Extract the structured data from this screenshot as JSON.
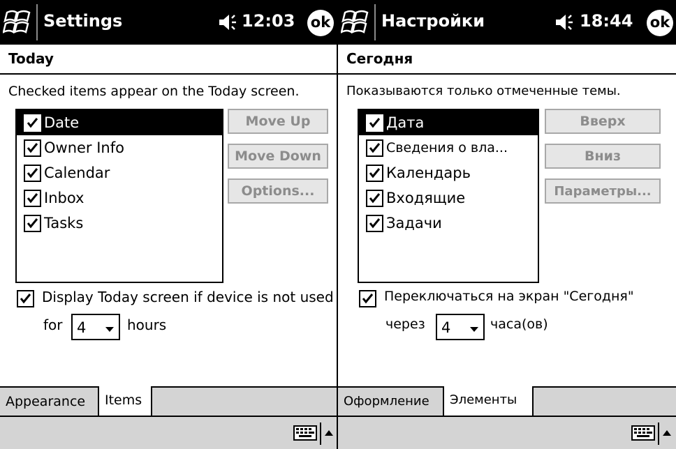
{
  "left": {
    "app_title": "Settings",
    "clock": "12:03",
    "ok_label": "ok",
    "page_title": "Today",
    "instruction": "Checked items appear on the Today screen.",
    "items": [
      {
        "label": "Date",
        "checked": true,
        "selected": true
      },
      {
        "label": "Owner Info",
        "checked": true
      },
      {
        "label": "Calendar",
        "checked": true
      },
      {
        "label": "Inbox",
        "checked": true
      },
      {
        "label": "Tasks",
        "checked": true
      }
    ],
    "buttons": {
      "move_up": "Move Up",
      "move_down": "Move Down",
      "options": "Options..."
    },
    "display_option": {
      "label": "Display Today screen if device is not used",
      "checked": true
    },
    "for_label": "for",
    "hours_value": "4",
    "hours_label": "hours",
    "tabs": {
      "appearance": "Appearance",
      "items": "Items"
    }
  },
  "right": {
    "app_title": "Настройки",
    "clock": "18:44",
    "ok_label": "ok",
    "page_title": "Сегодня",
    "instruction": "Показываются только отмеченные темы.",
    "items": [
      {
        "label": "Дата",
        "checked": true,
        "selected": true
      },
      {
        "label": "Сведения о вла...",
        "checked": true
      },
      {
        "label": "Календарь",
        "checked": true
      },
      {
        "label": "Входящие",
        "checked": true
      },
      {
        "label": "Задачи",
        "checked": true
      }
    ],
    "buttons": {
      "move_up": "Вверх",
      "move_down": "Вниз",
      "options": "Параметры..."
    },
    "display_option": {
      "label": "Переключаться на экран \"Сегодня\"",
      "checked": true
    },
    "for_label": "через",
    "hours_value": "4",
    "hours_label": "часа(ов)",
    "tabs": {
      "appearance": "Оформление",
      "items": "Элементы"
    }
  },
  "icons": [
    "windows-start-icon",
    "speaker-icon",
    "ok-icon",
    "checkbox-check-icon",
    "dropdown-arrow-icon",
    "keyboard-icon",
    "up-arrow-icon"
  ],
  "colors": {
    "titlebar": "#000000",
    "selection": "#000000",
    "disabled_text": "#8c8c8c",
    "tab_bar": "#d4d4d4"
  }
}
